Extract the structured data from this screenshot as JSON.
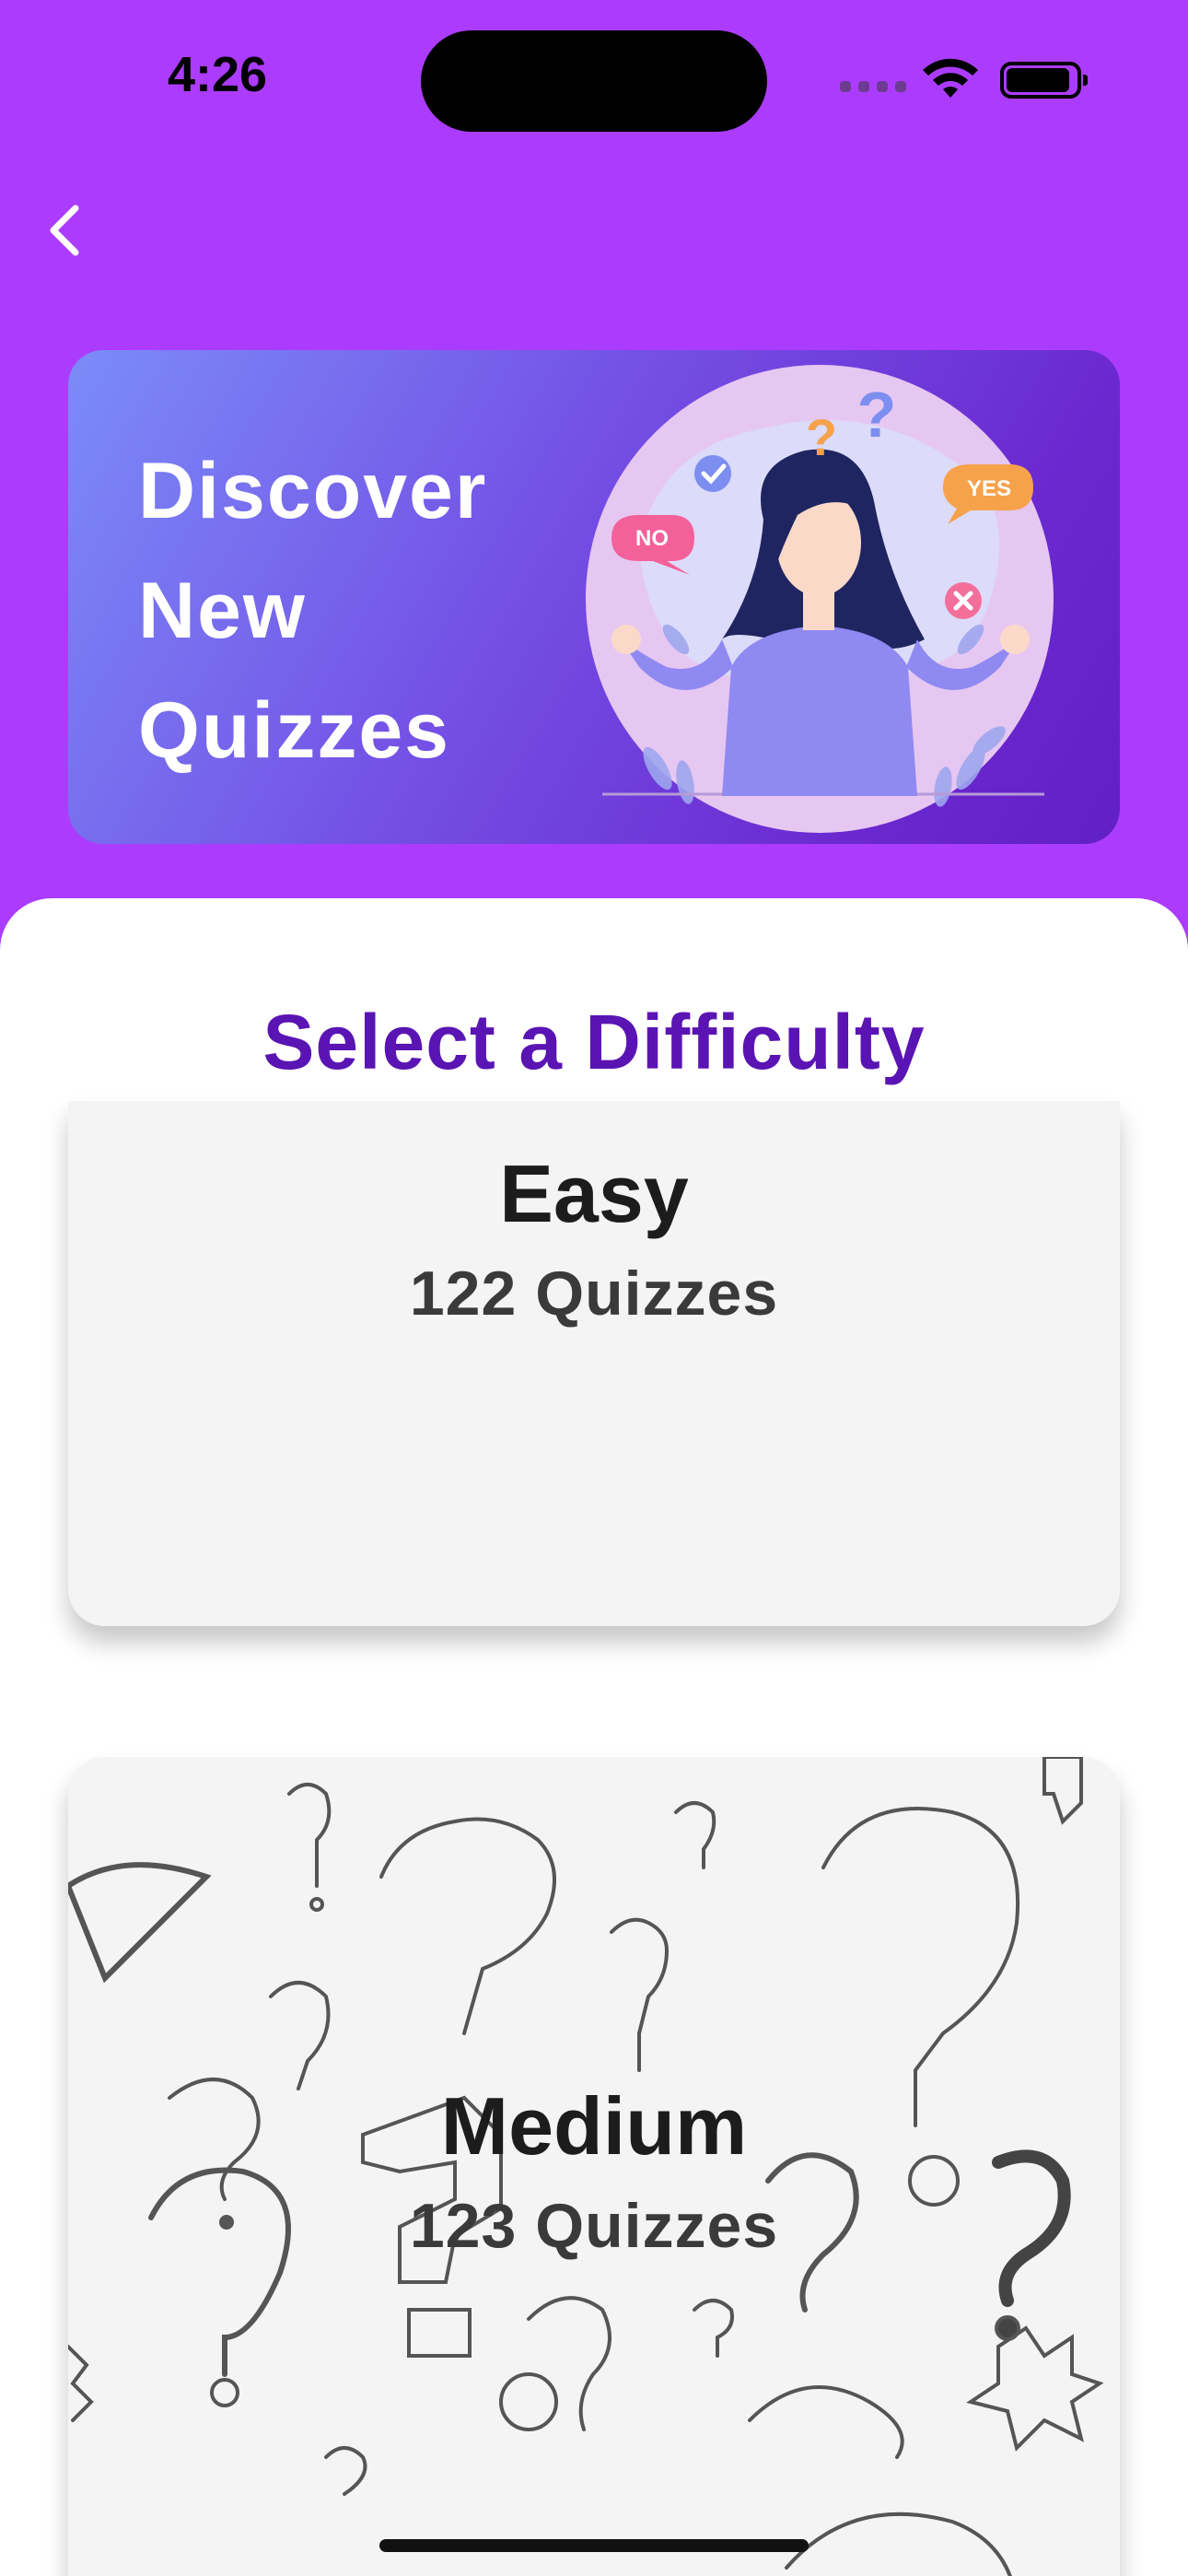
{
  "status_bar": {
    "time": "4:26",
    "icons": [
      "cellular-icon",
      "wifi-icon",
      "battery-icon"
    ]
  },
  "nav": {
    "back_icon": "chevron-left-icon"
  },
  "hero": {
    "title_lines": [
      "Discover",
      "New",
      "Quizzes"
    ],
    "illustration": {
      "bubble_no": "NO",
      "bubble_yes": "YES",
      "question_marks": [
        "?",
        "?"
      ]
    },
    "gradient": [
      "#7b8cf8",
      "#6120c4"
    ]
  },
  "content": {
    "section_title": "Select a Difficulty",
    "difficulties": [
      {
        "name": "Easy",
        "count_label": "122 Quizzes"
      },
      {
        "name": "Medium",
        "count_label": "123 Quizzes"
      }
    ]
  },
  "colors": {
    "background": "#ac3cfd",
    "section_title": "#5a14b3",
    "card_background": "#f4f4f4"
  }
}
